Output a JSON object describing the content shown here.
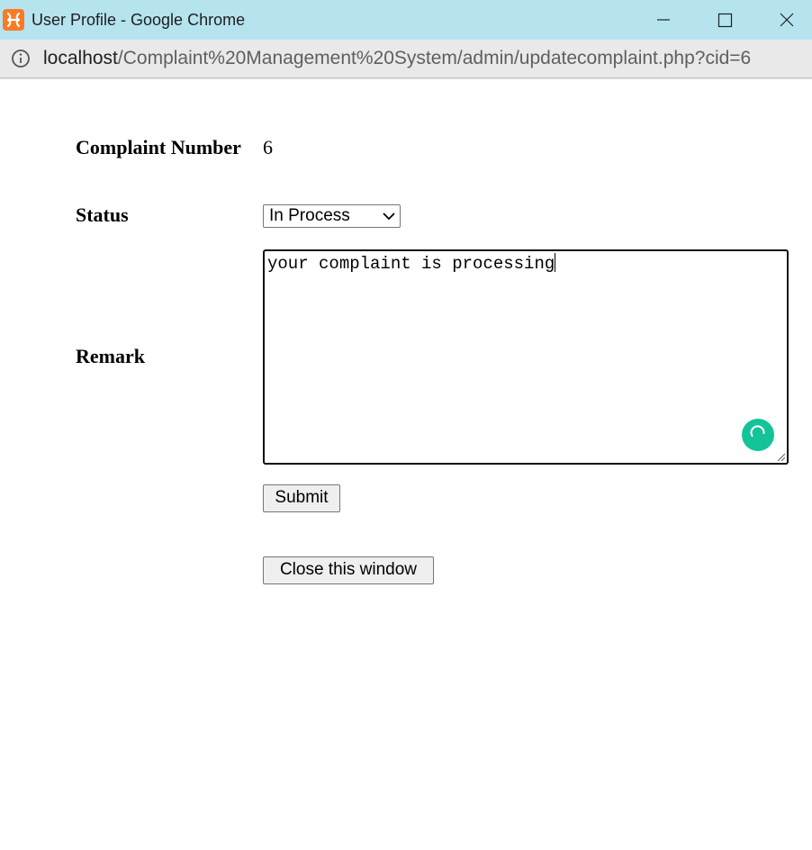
{
  "window": {
    "title": "User Profile - Google Chrome",
    "app_icon": "xampp-icon",
    "controls": [
      "minimize-icon",
      "maximize-icon",
      "close-icon"
    ]
  },
  "address_bar": {
    "host": "localhost",
    "path": "/Complaint%20Management%20System/admin/updatecomplaint.php?cid=6"
  },
  "form": {
    "complaint_number_label": "Complaint Number",
    "complaint_number_value": "6",
    "status_label": "Status",
    "status_selected": "In Process",
    "remark_label": "Remark",
    "remark_value": "your complaint is processing",
    "submit_label": "Submit",
    "close_label": "Close this window"
  },
  "colors": {
    "titlebar": "#b5e4ef",
    "addressbar": "#e9e9e9",
    "grammarly": "#15c39a",
    "xampp_icon": "#fb7a24"
  }
}
